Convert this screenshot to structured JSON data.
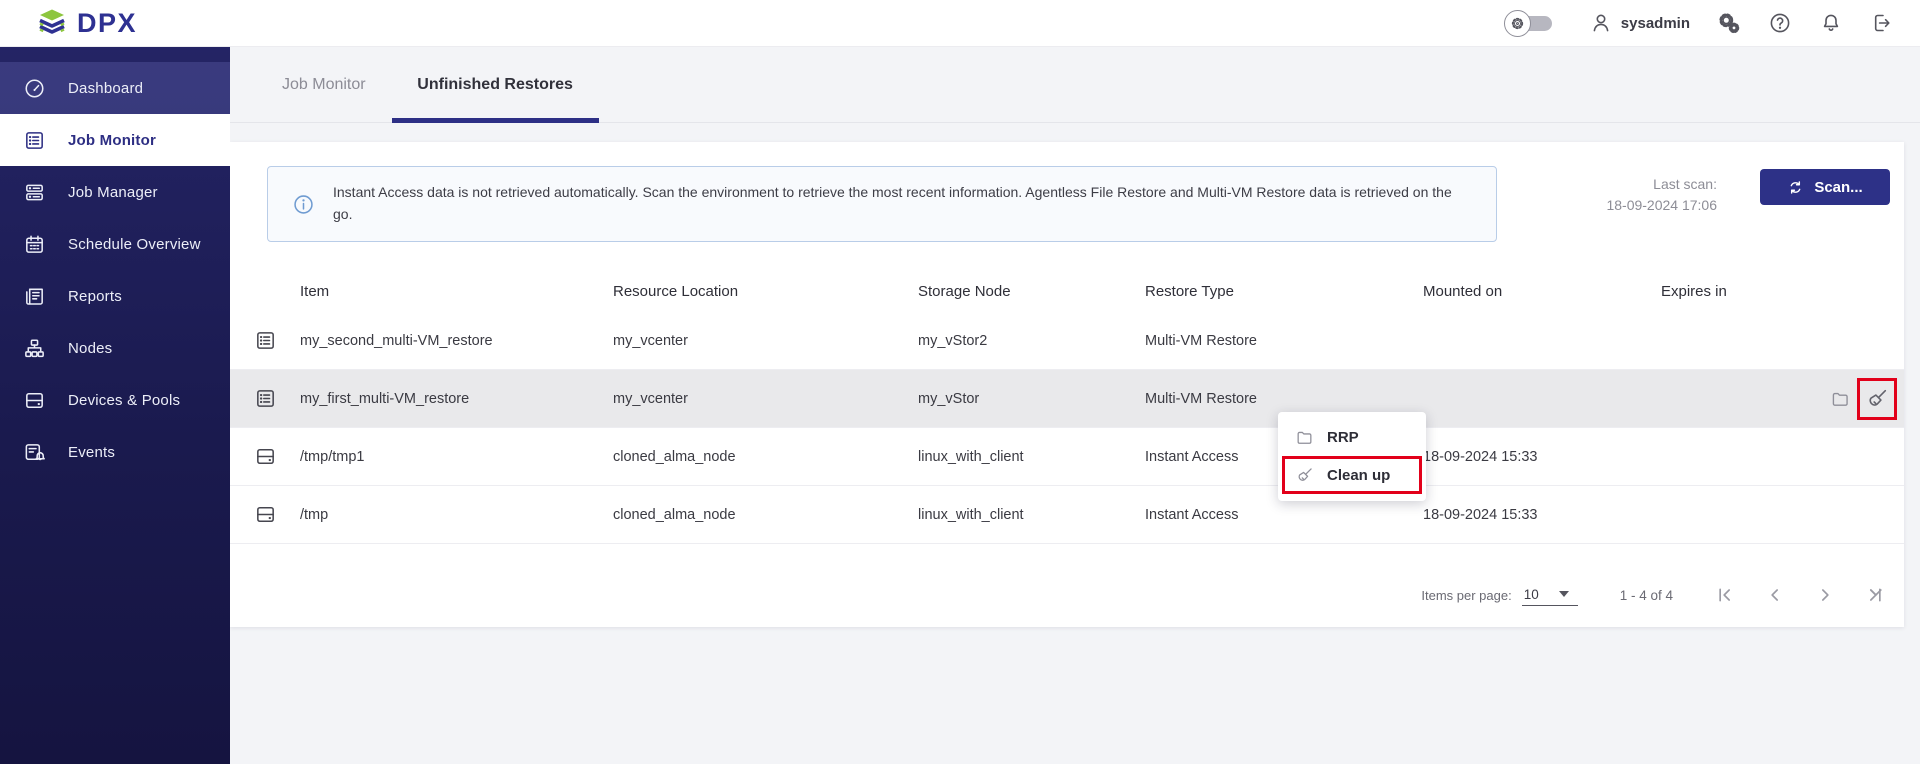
{
  "brand": {
    "name": "DPX",
    "logo_icon": "dpx-layers"
  },
  "topbar": {
    "username": "sysadmin",
    "icons": [
      "settings-toggle",
      "user",
      "admin-gears",
      "help",
      "notifications",
      "logout"
    ]
  },
  "sidebar": {
    "items": [
      {
        "label": "Dashboard",
        "icon": "gauge",
        "active": false
      },
      {
        "label": "Job Monitor",
        "icon": "job-monitor",
        "active": true
      },
      {
        "label": "Job Manager",
        "icon": "job-manager",
        "active": false
      },
      {
        "label": "Schedule Overview",
        "icon": "calendar",
        "active": false
      },
      {
        "label": "Reports",
        "icon": "reports",
        "active": false
      },
      {
        "label": "Nodes",
        "icon": "nodes",
        "active": false
      },
      {
        "label": "Devices & Pools",
        "icon": "drive",
        "active": false
      },
      {
        "label": "Events",
        "icon": "events",
        "active": false
      }
    ]
  },
  "tabs": [
    {
      "label": "Job Monitor",
      "active": false
    },
    {
      "label": "Unfinished Restores",
      "active": true
    }
  ],
  "banner": {
    "icon": "info",
    "text": "Instant Access data is not retrieved automatically. Scan the environment to retrieve the most recent information. Agentless File Restore and Multi-VM Restore data is retrieved on the go."
  },
  "scan": {
    "last_scan_label": "Last scan:",
    "last_scan_value": "18-09-2024 17:06",
    "button_label": "Scan...",
    "button_icon": "refresh",
    "button_color": "#2d3187"
  },
  "table": {
    "columns": [
      "Item",
      "Resource Location",
      "Storage Node",
      "Restore Type",
      "Mounted on",
      "Expires in"
    ],
    "rows": [
      {
        "icon": "multi-vm",
        "item": "my_second_multi-VM_restore",
        "resource_location": "my_vcenter",
        "storage_node": "my_vStor2",
        "restore_type": "Multi-VM Restore",
        "mounted_on": "",
        "expires_in": "",
        "highlighted": false,
        "actions": []
      },
      {
        "icon": "multi-vm",
        "item": "my_first_multi-VM_restore",
        "resource_location": "my_vcenter",
        "storage_node": "my_vStor",
        "restore_type": "Multi-VM Restore",
        "mounted_on": "",
        "expires_in": "",
        "highlighted": true,
        "actions": [
          {
            "icon": "rrp-folder",
            "annotated": false
          },
          {
            "icon": "broom",
            "annotated": true
          }
        ]
      },
      {
        "icon": "drive",
        "item": "/tmp/tmp1",
        "resource_location": "cloned_alma_node",
        "storage_node": "linux_with_client",
        "restore_type": "Instant Access",
        "mounted_on": "18-09-2024 15:33",
        "expires_in": "",
        "highlighted": false,
        "actions": []
      },
      {
        "icon": "drive",
        "item": "/tmp",
        "resource_location": "cloned_alma_node",
        "storage_node": "linux_with_client",
        "restore_type": "Instant Access",
        "mounted_on": "18-09-2024 15:33",
        "expires_in": "",
        "highlighted": false,
        "actions": []
      }
    ]
  },
  "context_menu": {
    "items": [
      {
        "label": "RRP",
        "icon": "rrp-folder",
        "annotated": false
      },
      {
        "label": "Clean up",
        "icon": "broom",
        "annotated": true
      }
    ]
  },
  "pagination": {
    "items_per_page_label": "Items per page:",
    "items_per_page_value": "10",
    "range_label": "1 - 4 of 4",
    "nav_icons": [
      "first-page",
      "prev-page",
      "next-page",
      "last-page"
    ]
  },
  "annotation": {
    "color": "#e2001a"
  }
}
